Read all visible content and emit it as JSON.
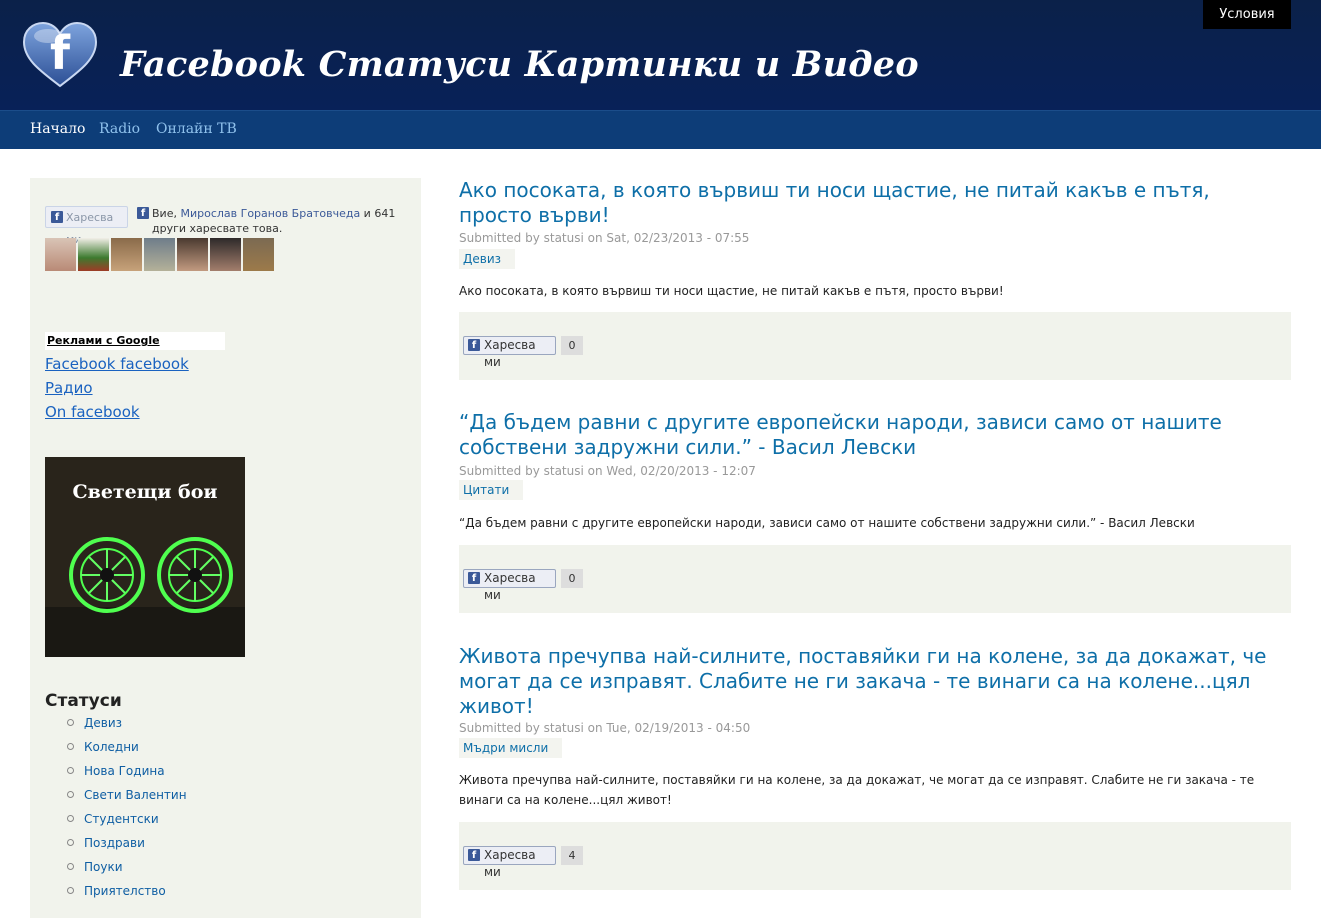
{
  "header": {
    "site_title": "Facebook Статуси Картинки и Видео",
    "terms_link": "Условия",
    "logo_letter": "f"
  },
  "nav": {
    "items": [
      {
        "label": "Начало",
        "active": true
      },
      {
        "label": "Radio",
        "active": false
      },
      {
        "label": "Онлайн ТВ",
        "active": false
      }
    ]
  },
  "sidebar": {
    "like_button_label": "Харесва ми",
    "like_text_prefix": "Вие, ",
    "like_text_name": "Мирослав Горанов Братовчеда",
    "like_text_suffix": " и 641 други харесвате това.",
    "ads_label": "Реклами с Google",
    "ad_links": [
      "Facebook facebook",
      "Радио",
      "On facebook"
    ],
    "promo_title": "Светещи бои",
    "statuses_heading": "Статуси",
    "categories": [
      "Девиз",
      "Коледни",
      "Нова Година",
      "Свети Валентин",
      "Студентски",
      "Поздрави",
      "Поуки",
      "Приятелство"
    ]
  },
  "posts": [
    {
      "title": "Ако посоката, в която вървиш ти носи щастие, не питай какъв е пътя, просто върви!",
      "meta": "Submitted by statusi on Sat, 02/23/2013 - 07:55",
      "tag": "Девиз",
      "body": "Ако посоката, в която вървиш ти носи щастие, не питай какъв е пътя, просто върви!",
      "like_label": "Харесва ми",
      "like_count": "0"
    },
    {
      "title": "“Да бъдем равни с другите европейски народи, зависи само от нашите собствени задружни сили.” - Васил Левски",
      "meta": "Submitted by statusi on Wed, 02/20/2013 - 12:07",
      "tag": "Цитати",
      "body": "“Да бъдем равни с другите европейски народи, зависи само от нашите собствени задружни сили.” - Васил Левски",
      "like_label": "Харесва ми",
      "like_count": "0"
    },
    {
      "title": "Живота пречупва най-силните, поставяйки ги на колене, за да докажат, че могат да се изправят. Слабите не ги закача - те винаги са на колене...цял живот!",
      "meta": "Submitted by statusi on Tue, 02/19/2013 - 04:50",
      "tag": "Мъдри мисли",
      "body": "Живота пречупва най-силните, поставяйки ги на колене, за да докажат, че могат да се изправят. Слабите не ги закача - те винаги са на колене...цял живот!",
      "like_label": "Харесва ми",
      "like_count": "4"
    }
  ],
  "colors": {
    "header_bg": "#0b2149",
    "nav_bg": "#0d3d78",
    "link_blue": "#0e6fa8",
    "sidebar_bg": "#f1f3ec",
    "fb_blue": "#3b5998"
  }
}
